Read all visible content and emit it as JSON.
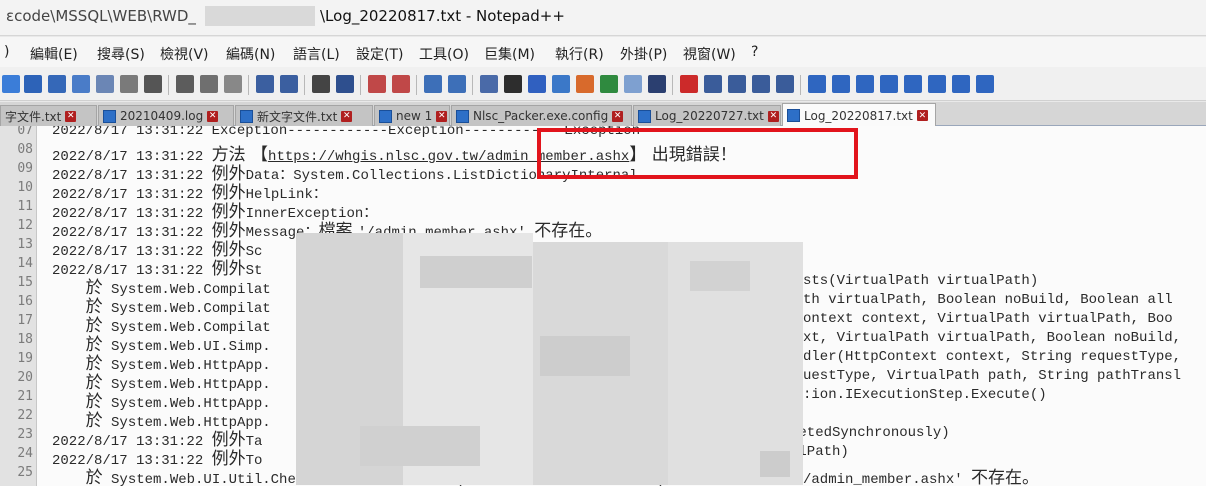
{
  "titlebar": {
    "path_prefix": "ɛcode\\MSSQL\\WEB\\RWD_",
    "title": "\\Log_20220817.txt - Notepad++"
  },
  "menu": [
    "編輯(E)",
    "搜尋(S)",
    "檢視(V)",
    "編碼(N)",
    "語言(L)",
    "設定(T)",
    "工具(O)",
    "巨集(M)",
    "執行(R)",
    "外掛(P)",
    "視窗(W)",
    "?"
  ],
  "menu_lead": ")",
  "tabs": [
    {
      "label": "字文件.txt"
    },
    {
      "label": "20210409.log"
    },
    {
      "label": "新文字文件.txt"
    },
    {
      "label": "new 1"
    },
    {
      "label": "Nlsc_Packer.exe.config"
    },
    {
      "label": "Log_20220727.txt"
    },
    {
      "label": "Log_20220817.txt",
      "active": true
    }
  ],
  "gutter": [
    "07",
    "08",
    "09",
    "10",
    "11",
    "12",
    "13",
    "14",
    "15",
    "16",
    "17",
    "18",
    "19",
    "20",
    "21",
    "22",
    "23",
    "24",
    "25"
  ],
  "lines": [
    {
      "text": "2022/8/17 13:31:22 Exception------------Exception------------Exception"
    },
    {
      "pre": "2022/8/17 13:31:22 ",
      "cjk1": "方法 【",
      "url": "https://whgis.nlsc.gov.tw/admin_member.ashx",
      "cjk2": "】 出現錯誤！"
    },
    {
      "pre": "2022/8/17 13:31:22 ",
      "cjk1": "例外",
      "post": "Data：System.Collections.ListDictionaryInternal"
    },
    {
      "pre": "2022/8/17 13:31:22 ",
      "cjk1": "例外",
      "post": "HelpLink："
    },
    {
      "pre": "2022/8/17 13:31:22 ",
      "cjk1": "例外",
      "post": "InnerException："
    },
    {
      "pre": "2022/8/17 13:31:22 ",
      "cjk1": "例外",
      "post": "Message：",
      "cjk2": "檔案 ",
      "post2": "'/admin member.ashx' ",
      "cjk3": "不存在。"
    },
    {
      "pre": "2022/8/17 13:31:22 ",
      "cjk1": "例外",
      "post": "Sc"
    },
    {
      "pre": "2022/8/17 13:31:22 ",
      "cjk1": "例外",
      "post": "St"
    },
    {
      "pre": "    ",
      "cjk1": "於",
      "post": " System.Web.Compilat"
    },
    {
      "pre": "    ",
      "cjk1": "於",
      "post": " System.Web.Compilat"
    },
    {
      "pre": "    ",
      "cjk1": "於",
      "post": " System.Web.Compilat"
    },
    {
      "pre": "    ",
      "cjk1": "於",
      "post": " System.Web.UI.Simp."
    },
    {
      "pre": "    ",
      "cjk1": "於",
      "post": " System.Web.HttpApp."
    },
    {
      "pre": "    ",
      "cjk1": "於",
      "post": " System.Web.HttpApp."
    },
    {
      "pre": "    ",
      "cjk1": "於",
      "post": " System.Web.HttpApp."
    },
    {
      "pre": "    ",
      "cjk1": "於",
      "post": " System.Web.HttpApp."
    },
    {
      "pre": "2022/8/17 13:31:22 ",
      "cjk1": "例外",
      "post": "Ta"
    },
    {
      "pre": "2022/8/17 13:31:22 ",
      "cjk1": "例外",
      "post": "To"
    },
    {
      "pre": "    ",
      "cjk1": "於",
      "post": " System.Web.UI.Util.CheckVirtualFileExists(VirtualPath virtualPath)"
    }
  ],
  "right_lines": [
    "sts(VirtualPath virtualPath)",
    "th virtualPath, Boolean noBuild, Boolean all",
    "ontext context, VirtualPath virtualPath, Boo",
    "xt, VirtualPath virtualPath, Boolean noBuild,",
    "dler(HttpContext context, String requestType,",
    "uestType, VirtualPath path, String pathTransl",
    ":ion.IExecutionStep.Execute()",
    "",
    "letedSynchronously)",
    "alPath)"
  ],
  "right_last": {
    "text": "/admin_member.ashx' ",
    "cjk": "不存在。"
  }
}
